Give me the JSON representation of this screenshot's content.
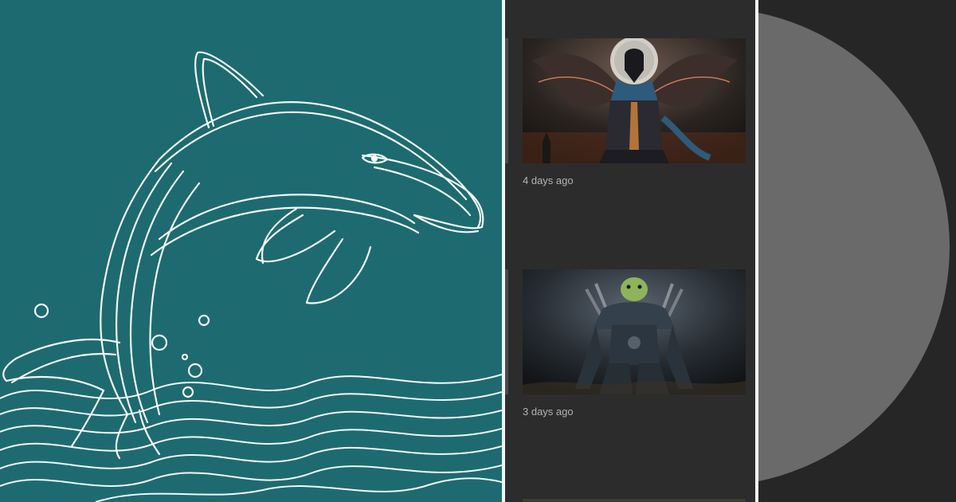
{
  "feed": {
    "cards": [
      {
        "time": "4 days ago",
        "image": "raven-knight-artwork"
      },
      {
        "time": "3 days ago",
        "image": "turtle-warrior-artwork"
      }
    ]
  },
  "colors": {
    "teal_background": "#1d6b70",
    "line_art": "#ffffff",
    "feed_background": "#2c2c2c",
    "timestamp": "#b3b3b3",
    "disc": "#6a6a6a"
  }
}
